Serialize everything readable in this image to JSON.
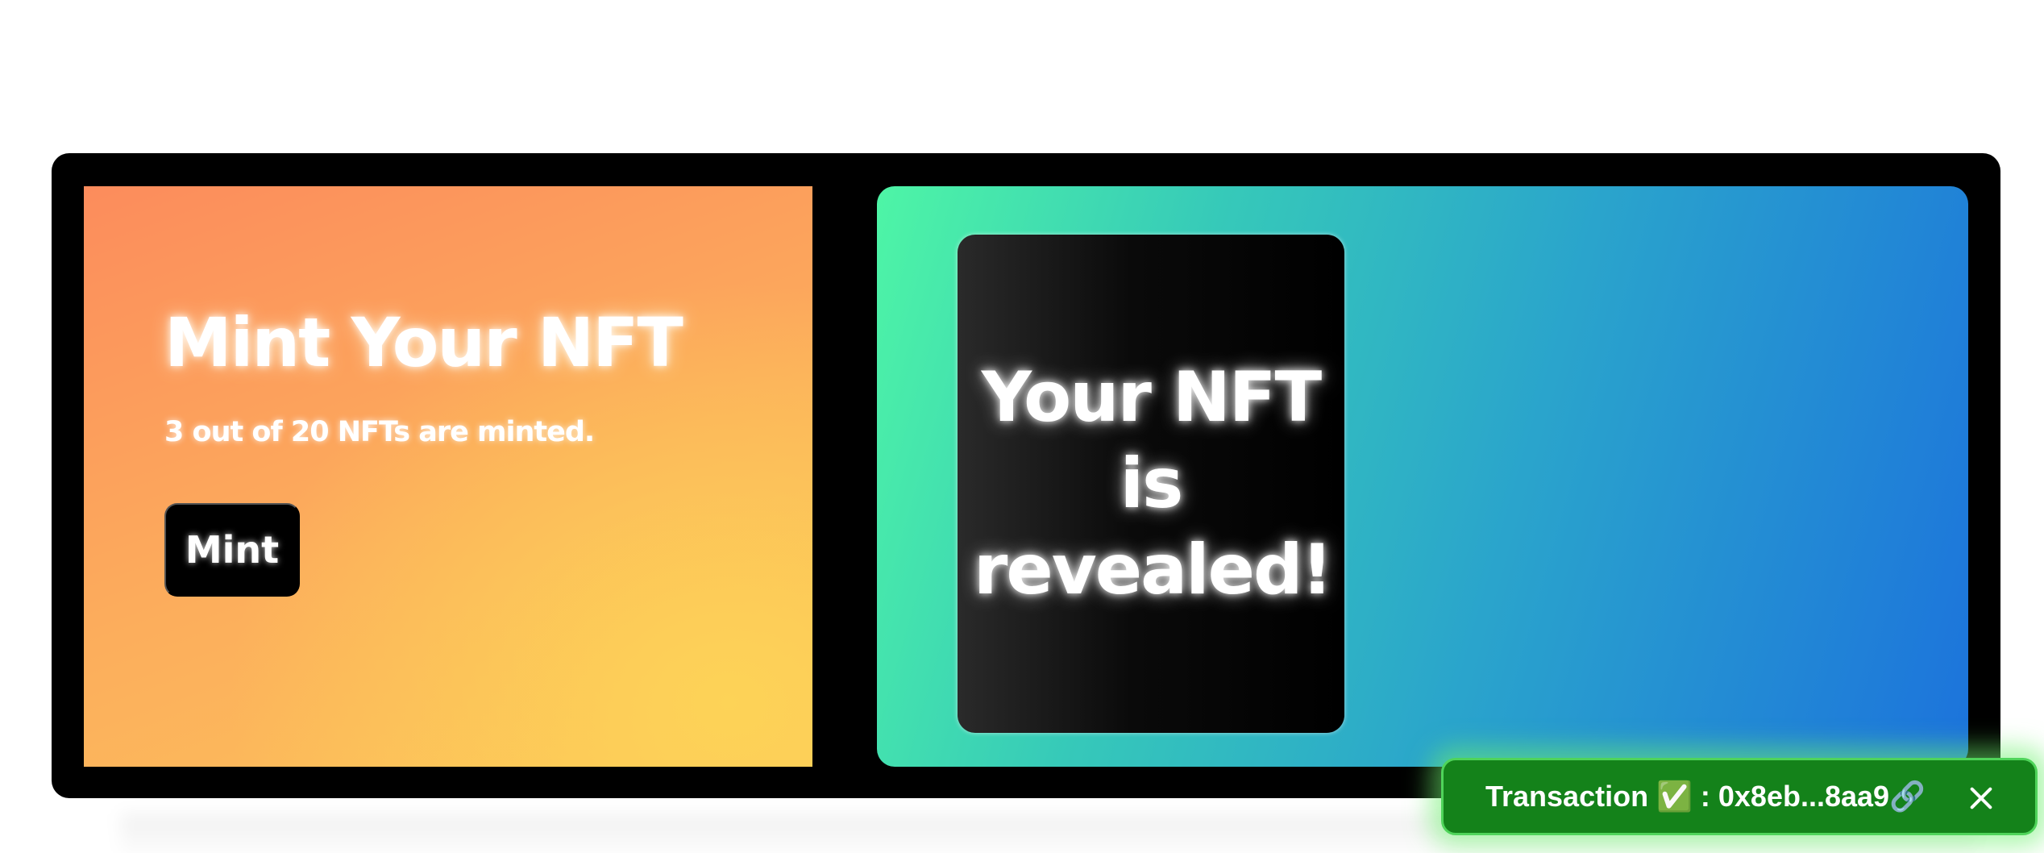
{
  "mint_panel": {
    "title": "Mint Your NFT",
    "status": "3 out of 20 NFTs are minted.",
    "minted": 3,
    "total": 20,
    "button_label": "Mint"
  },
  "reveal_panel": {
    "card_text": "Your NFT is revealed!"
  },
  "toast": {
    "message": "Transaction ✅ : 0x8eb...8aa9🔗",
    "close_icon": "close-icon",
    "background_color": "#14821a"
  },
  "colors": {
    "frame": "#000000",
    "mint_gradient_start": "#fc8c5c",
    "mint_gradient_end": "#fdd357",
    "reveal_gradient_start": "#4ef5a6",
    "reveal_gradient_end": "#1c73dc"
  }
}
